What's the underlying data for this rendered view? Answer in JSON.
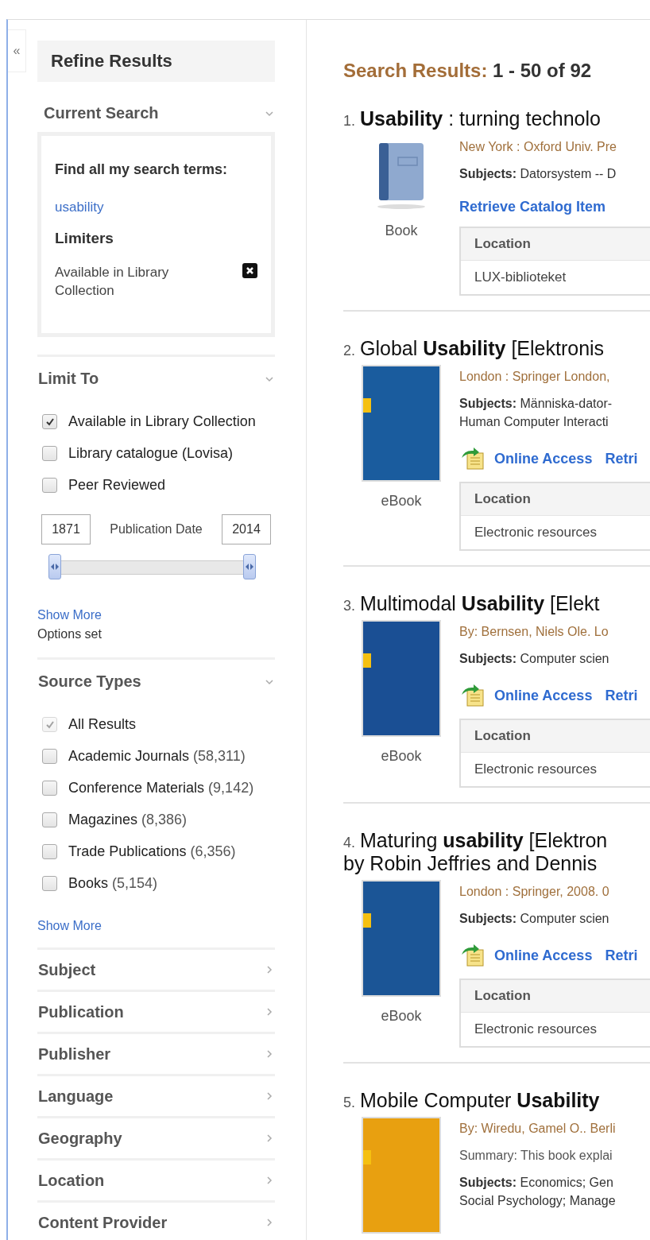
{
  "sidebar": {
    "collapse_button": "«",
    "title": "Refine Results",
    "current_search": {
      "heading": "Current Search",
      "expanded": true,
      "find_label": "Find all my search terms:",
      "term": "usability",
      "limiters_label": "Limiters",
      "limiters": [
        {
          "label": "Available in Library Collection"
        }
      ]
    },
    "limit_to": {
      "heading": "Limit To",
      "expanded": true,
      "options": [
        {
          "label": "Available in Library Collection",
          "checked": true,
          "disabled": false
        },
        {
          "label": "Library catalogue (Lovisa)",
          "checked": false,
          "disabled": false
        },
        {
          "label": "Peer Reviewed",
          "checked": false,
          "disabled": false
        }
      ],
      "date_range": {
        "from": "1871",
        "label": "Publication Date",
        "to": "2014",
        "handles": [
          {
            "level": 0
          },
          {
            "level": 1
          }
        ]
      },
      "show_more": "Show More",
      "options_set": "Options set"
    },
    "source_types": {
      "heading": "Source Types",
      "expanded": true,
      "options": [
        {
          "label": "All Results",
          "checked": true,
          "disabled": true
        },
        {
          "label": "Academic Journals",
          "count": "(58,311)",
          "checked": false,
          "disabled": false
        },
        {
          "label": "Conference Materials",
          "count": "(9,142)",
          "checked": false,
          "disabled": false
        },
        {
          "label": "Magazines",
          "count": "(8,386)",
          "checked": false,
          "disabled": false
        },
        {
          "label": "Trade Publications",
          "count": "(6,356)",
          "checked": false,
          "disabled": false
        },
        {
          "label": "Books",
          "count": "(5,154)",
          "checked": false,
          "disabled": false
        }
      ],
      "show_more": "Show More"
    },
    "facets": [
      {
        "label": "Subject",
        "expanded": false
      },
      {
        "label": "Publication",
        "expanded": false
      },
      {
        "label": "Publisher",
        "expanded": false
      },
      {
        "label": "Language",
        "expanded": false
      },
      {
        "label": "Geography",
        "expanded": false
      },
      {
        "label": "Location",
        "expanded": false
      },
      {
        "label": "Content Provider",
        "expanded": false
      }
    ]
  },
  "results": {
    "heading": "Search Results:",
    "range": "1 - 50 of 92",
    "items": [
      {
        "number": "1.",
        "title": [
          "**Usability** : turning technolo"
        ],
        "thumbnail": {
          "kind": "icon"
        },
        "type": "Book",
        "meta": [
          {
            "kind": "publisher",
            "text": "New York : Oxford Univ. Pre"
          }
        ],
        "subjects": [
          "**Subjects:** Datorsystem -- D"
        ],
        "links": [
          {
            "kind": "catalog",
            "label": "Retrieve Catalog Item"
          }
        ],
        "location": {
          "header": "Location",
          "value": "LUX-biblioteket"
        }
      },
      {
        "number": "2.",
        "title": [
          "Global **Usability** [Elektronis"
        ],
        "thumbnail": {
          "kind": "cover",
          "color": "#1a5c9e"
        },
        "type": "eBook",
        "meta": [
          {
            "kind": "publisher",
            "text": "London : Springer London,"
          }
        ],
        "subjects": [
          "**Subjects:** Människa-dator-",
          "Human Computer Interacti"
        ],
        "links": [
          {
            "kind": "online",
            "label": "Online Access"
          },
          {
            "kind": "catalog",
            "label": "Retri"
          }
        ],
        "location": {
          "header": "Location",
          "value": "Electronic resources"
        }
      },
      {
        "number": "3.",
        "title": [
          "Multimodal **Usability** [Elekt"
        ],
        "thumbnail": {
          "kind": "cover",
          "color": "#1a4f94"
        },
        "type": "eBook",
        "meta": [
          {
            "kind": "publisher",
            "text": "By: Bernsen, Niels Ole. Lo"
          }
        ],
        "subjects": [
          "**Subjects:** Computer scien"
        ],
        "links": [
          {
            "kind": "online",
            "label": "Online Access"
          },
          {
            "kind": "catalog",
            "label": "Retri"
          }
        ],
        "location": {
          "header": "Location",
          "value": "Electronic resources"
        }
      },
      {
        "number": "4.",
        "title": [
          "Maturing **usability** [Elektron",
          "by Robin Jeffries and Dennis"
        ],
        "thumbnail": {
          "kind": "cover",
          "color": "#1b5596"
        },
        "type": "eBook",
        "meta": [
          {
            "kind": "publisher",
            "text": "London : Springer, 2008. 0"
          }
        ],
        "subjects": [
          "**Subjects:** Computer scien"
        ],
        "links": [
          {
            "kind": "online",
            "label": "Online Access"
          },
          {
            "kind": "catalog",
            "label": "Retri"
          }
        ],
        "location": {
          "header": "Location",
          "value": "Electronic resources"
        }
      },
      {
        "number": "5.",
        "title": [
          "Mobile Computer **Usability**"
        ],
        "thumbnail": {
          "kind": "cover",
          "color": "#e8a010"
        },
        "meta": [
          {
            "kind": "publisher",
            "text": "By: Wiredu, Gamel O.. Berli"
          },
          {
            "kind": "summary",
            "text": "Summary: This book explai"
          }
        ],
        "subjects": [
          "**Subjects:** Economics; Gen",
          "Social Psychology; Manage"
        ]
      }
    ]
  }
}
